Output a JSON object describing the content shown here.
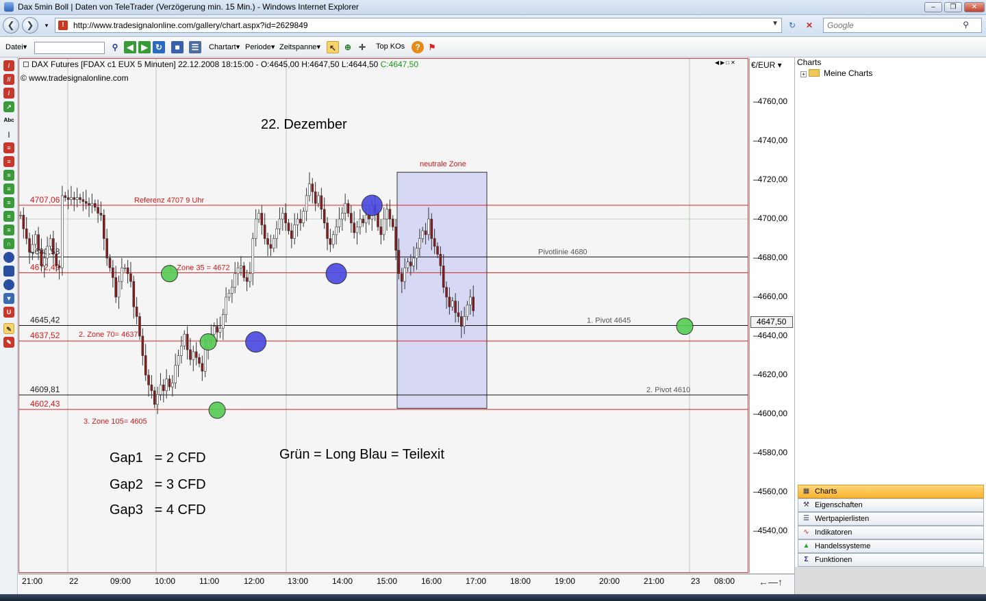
{
  "window": {
    "title": "Dax 5min Boll | Daten von TeleTrader (Verzögerung min. 15 Min.) - Windows Internet Explorer"
  },
  "address": {
    "url": "http://www.tradesignalonline.com/gallery/chart.aspx?id=2629849",
    "search_placeholder": "Google"
  },
  "toolbar": {
    "datei": "Datei",
    "chartart": "Chartart",
    "periode": "Periode",
    "zeitspanne": "Zeitspanne",
    "topkos": "Top KOs"
  },
  "chart": {
    "header_prefix": "DAX Futures [FDAX c1 EUX  5 Minuten] 22.12.2008 18:15:00 - O:4645,00 H:4647,50 L:4644,50 ",
    "header_close": "C:4647,50",
    "copyright": "© www.tradesignalonline.com",
    "unit": "€/EUR",
    "current_price": "4647,50",
    "title_annotation": "22. Dezember",
    "neutral_zone": "neutrale Zone",
    "legend_text": "Grün = Long Blau = Teilexit",
    "gaps": [
      "Gap1   = 2 CFD",
      "Gap2   = 3 CFD",
      "Gap3   = 4 CFD"
    ],
    "colors": {
      "red_line": "#e02020",
      "black_line": "#111111",
      "green_marker": "#55cc55",
      "blue_marker": "#4848e0",
      "neutral_fill": "#d6d8f4",
      "candle": "#8b1a1a"
    }
  },
  "chart_data": {
    "type": "candlestick",
    "instrument": "DAX Futures [FDAX c1 EUX  5 Minuten]",
    "y_ticks": [
      "4760,00",
      "4740,00",
      "4720,00",
      "4700,00",
      "4680,00",
      "4660,00",
      "4640,00",
      "4620,00",
      "4600,00",
      "4580,00",
      "4560,00",
      "4540,00"
    ],
    "ylim": [
      4525,
      4780
    ],
    "x_ticks": [
      "21:00",
      "22",
      "09:00",
      "10:00",
      "11:00",
      "12:00",
      "13:00",
      "14:00",
      "15:00",
      "16:00",
      "17:00",
      "18:00",
      "19:00",
      "20:00",
      "21:00",
      "23",
      "08:00"
    ],
    "horizontal_levels": [
      {
        "value": 4707.06,
        "label": "4707,06",
        "note": "Referenz 4707  9 Uhr",
        "color": "#e02020"
      },
      {
        "value": 4680.58,
        "label": "4680,58",
        "note": "Pivotlinie 4680",
        "color": "#111111"
      },
      {
        "value": 4672.49,
        "label": "4672,49",
        "note": "1. Zone 35 = 4672",
        "color": "#e02020"
      },
      {
        "value": 4645.42,
        "label": "4645,42",
        "note": "1. Pivot 4645",
        "color": "#111111"
      },
      {
        "value": 4637.52,
        "label": "4637,52",
        "note": "2. Zone 70= 4637",
        "color": "#e02020"
      },
      {
        "value": 4609.81,
        "label": "4609,81",
        "note": "2. Pivot 4610",
        "color": "#111111"
      },
      {
        "value": 4602.43,
        "label": "4602,43",
        "note": "3. Zone 105= 4605",
        "color": "#e02020"
      }
    ],
    "neutral_zone_range": [
      4603,
      4724
    ],
    "markers": [
      {
        "time_index": 50,
        "price": 4672,
        "type": "long"
      },
      {
        "time_index": 63,
        "price": 4637,
        "type": "long"
      },
      {
        "time_index": 66,
        "price": 4602,
        "type": "long"
      },
      {
        "time_index": 79,
        "price": 4637,
        "type": "partial-exit"
      },
      {
        "time_index": 106,
        "price": 4672,
        "type": "partial-exit"
      },
      {
        "time_index": 118,
        "price": 4707,
        "type": "partial-exit"
      },
      {
        "time_index": 223,
        "price": 4645,
        "type": "long"
      }
    ],
    "closes": [
      4702,
      4695,
      4690,
      4683,
      4687,
      4692,
      4684,
      4676,
      4680,
      4686,
      4690,
      4682,
      4676,
      4675,
      4712,
      4711,
      4710,
      4711,
      4710,
      4711,
      4710,
      4709,
      4708,
      4707,
      4708,
      4706,
      4703,
      4702,
      4690,
      4680,
      4675,
      4670,
      4660,
      4668,
      4675,
      4675,
      4672,
      4668,
      4655,
      4650,
      4640,
      4630,
      4620,
      4615,
      4612,
      4605,
      4610,
      4615,
      4612,
      4618,
      4614,
      4616,
      4625,
      4630,
      4635,
      4641,
      4633,
      4628,
      4632,
      4629,
      4626,
      4622,
      4634,
      4638,
      4641,
      4645,
      4642,
      4644,
      4651,
      4660,
      4662,
      4665,
      4672,
      4675,
      4676,
      4670,
      4668,
      4672,
      4690,
      4700,
      4703,
      4697,
      4690,
      4687,
      4685,
      4690,
      4695,
      4700,
      4703,
      4698,
      4694,
      4690,
      4697,
      4700,
      4698,
      4704,
      4712,
      4718,
      4714,
      4708,
      4712,
      4705,
      4698,
      4690,
      4687,
      4692,
      4696,
      4700,
      4703,
      4708,
      4703,
      4698,
      4693,
      4696,
      4700,
      4698,
      4702,
      4700,
      4707,
      4703,
      4696,
      4692,
      4700,
      4705,
      4700,
      4696,
      4684,
      4672,
      4668,
      4675,
      4678,
      4676,
      4680,
      4685,
      4690,
      4694,
      4692,
      4700,
      4690,
      4686,
      4682,
      4676,
      4665,
      4660,
      4655,
      4658,
      4652,
      4650,
      4645,
      4650,
      4656,
      4660,
      4653
    ]
  }
}
